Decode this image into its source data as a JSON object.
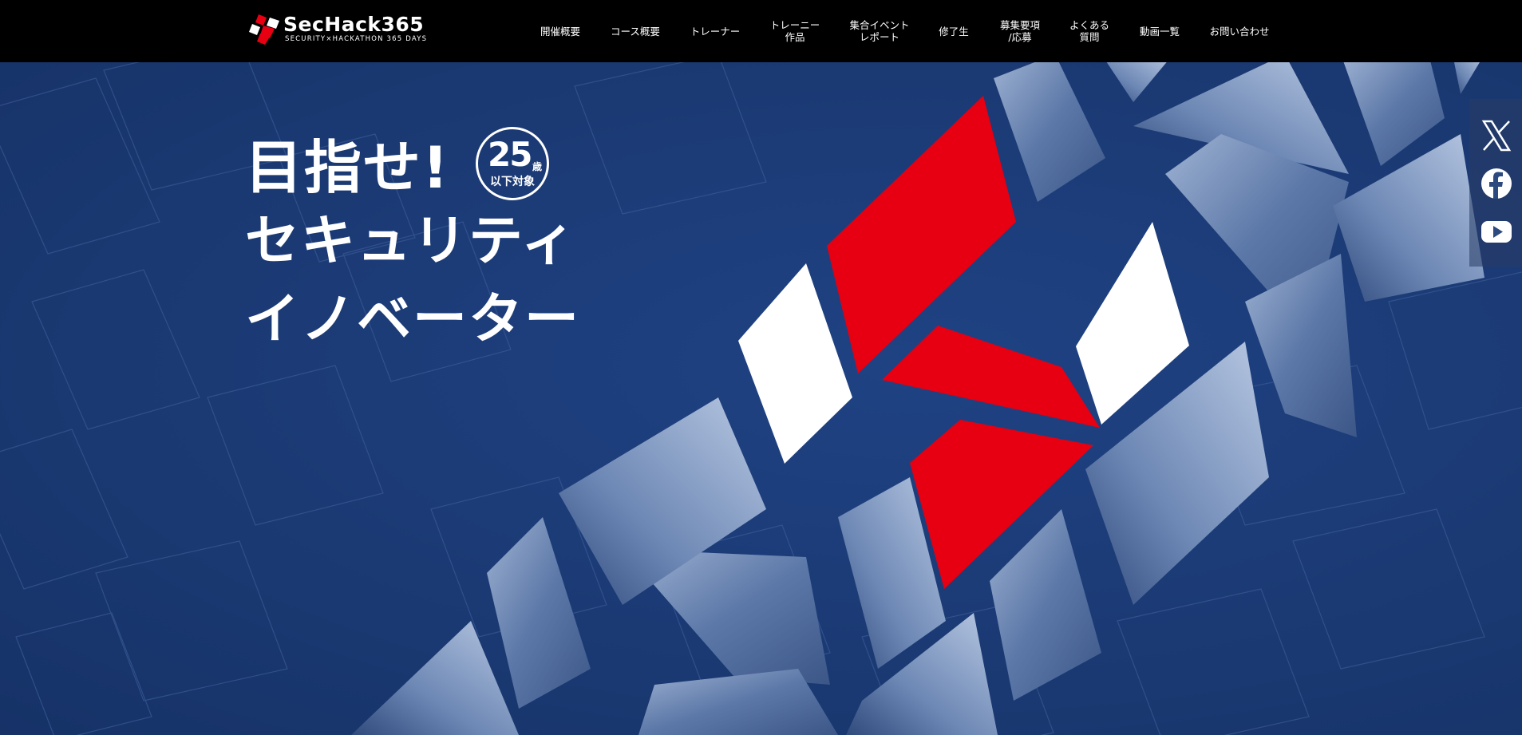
{
  "brand": {
    "name": "SecHack365",
    "tagline": "SECURITY×HACKATHON 365 DAYS"
  },
  "nav": {
    "items": [
      {
        "label": "開催概要"
      },
      {
        "label": "コース概要"
      },
      {
        "label": "トレーナー"
      },
      {
        "label": "トレーニー\n作品"
      },
      {
        "label": "集合イベント\nレポート"
      },
      {
        "label": "修了生"
      },
      {
        "label": "募集要項\n/応募"
      },
      {
        "label": "よくある\n質問"
      },
      {
        "label": "動画一覧"
      },
      {
        "label": "お問い合わせ"
      }
    ]
  },
  "hero": {
    "line1": "目指せ!",
    "line2": "セキュリティ",
    "line3": "イノベーター",
    "badge": {
      "number": "25",
      "unit": "歳",
      "label": "以下対象"
    }
  },
  "social": {
    "items": [
      {
        "icon": "x-icon"
      },
      {
        "icon": "facebook-icon"
      },
      {
        "icon": "youtube-icon"
      }
    ]
  },
  "colors": {
    "header_bg": "#000000",
    "hero_bg": "#1b3a74",
    "accent_red": "#e60012",
    "white": "#ffffff",
    "photo_tint": "#6f8ab3"
  }
}
